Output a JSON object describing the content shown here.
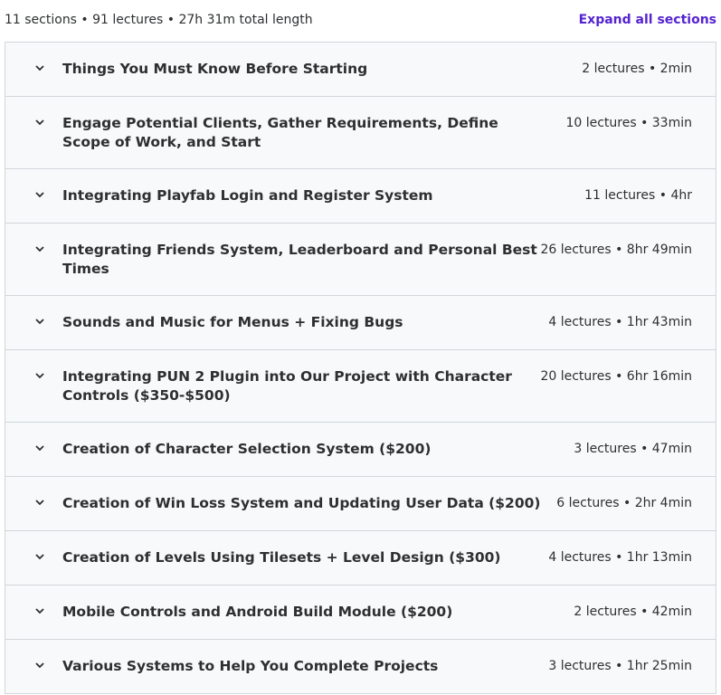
{
  "summary": {
    "text": "11 sections • 91 lectures • 27h 31m total length",
    "expand_label": "Expand all sections"
  },
  "sections": [
    {
      "title": "Things You Must Know Before Starting",
      "meta": "2 lectures • 2min"
    },
    {
      "title": "Engage Potential Clients, Gather Requirements, Define Scope of Work, and Start",
      "meta": "10 lectures • 33min"
    },
    {
      "title": "Integrating Playfab Login and Register System",
      "meta": "11 lectures • 4hr"
    },
    {
      "title": "Integrating Friends System, Leaderboard and Personal Best Times",
      "meta": "26 lectures • 8hr 49min"
    },
    {
      "title": "Sounds and Music for Menus + Fixing Bugs",
      "meta": "4 lectures • 1hr 43min"
    },
    {
      "title": "Integrating PUN 2 Plugin into Our Project with Character Controls ($350-$500)",
      "meta": "20 lectures • 6hr 16min"
    },
    {
      "title": "Creation of Character Selection System ($200)",
      "meta": "3 lectures • 47min"
    },
    {
      "title": "Creation of Win Loss System and Updating User Data ($200)",
      "meta": "6 lectures • 2hr 4min"
    },
    {
      "title": "Creation of Levels Using Tilesets + Level Design ($300)",
      "meta": "4 lectures • 1hr 13min"
    },
    {
      "title": "Mobile Controls and Android Build Module ($200)",
      "meta": "2 lectures • 42min"
    },
    {
      "title": "Various Systems to Help You Complete Projects",
      "meta": "3 lectures • 1hr 25min"
    }
  ],
  "icons": {
    "section_toggle": "chevron-down-icon"
  },
  "colors": {
    "accent": "#5624d0",
    "row_bg": "#f7f9fa",
    "border": "#d1d7dc",
    "text": "#2d2f31"
  }
}
